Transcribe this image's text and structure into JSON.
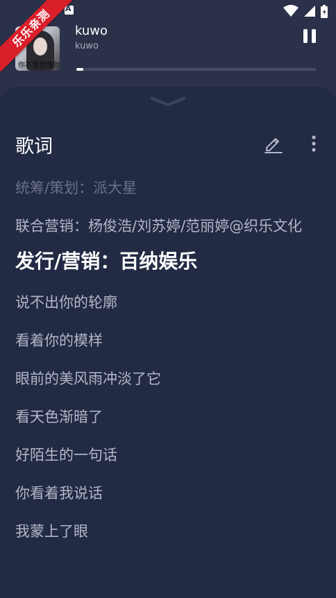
{
  "status_bar": {
    "notification_icon": "accessibility-a-icon",
    "icons": [
      "wifi-icon",
      "signal-icon",
      "battery-charging-icon"
    ]
  },
  "watermark": {
    "text": "乐乐亲测",
    "color": "#d91f2a"
  },
  "now_playing": {
    "album_art_text": "你不懂我懂你我懂",
    "title": "kuwo",
    "artist": "kuwo",
    "progress": 0.03,
    "pause_icon": "pause-icon"
  },
  "lyrics_panel": {
    "collapse_icon": "chevron-down-icon",
    "title": "歌词",
    "edit_icon": "pencil-icon",
    "more_icon": "more-vertical-icon",
    "lines": [
      {
        "text": "统筹/策划：派大星",
        "state": "faded"
      },
      {
        "text": "联合营销：杨俊浩/刘苏婷/范丽婷@织乐文化",
        "state": "normal"
      },
      {
        "text": "发行/营销：百纳娱乐",
        "state": "current"
      },
      {
        "text": "说不出你的轮廓",
        "state": "normal"
      },
      {
        "text": "看着你的模样",
        "state": "normal"
      },
      {
        "text": "眼前的美风雨冲淡了它",
        "state": "normal"
      },
      {
        "text": "看天色渐暗了",
        "state": "normal"
      },
      {
        "text": "好陌生的一句话",
        "state": "normal"
      },
      {
        "text": "你看着我说话",
        "state": "normal"
      },
      {
        "text": "我蒙上了眼",
        "state": "normal"
      }
    ]
  },
  "colors": {
    "background": "#2a3048",
    "panel": "#222a44",
    "text_primary": "#ffffff",
    "text_secondary": "#b3b8c7",
    "text_faded": "#6b7189"
  }
}
